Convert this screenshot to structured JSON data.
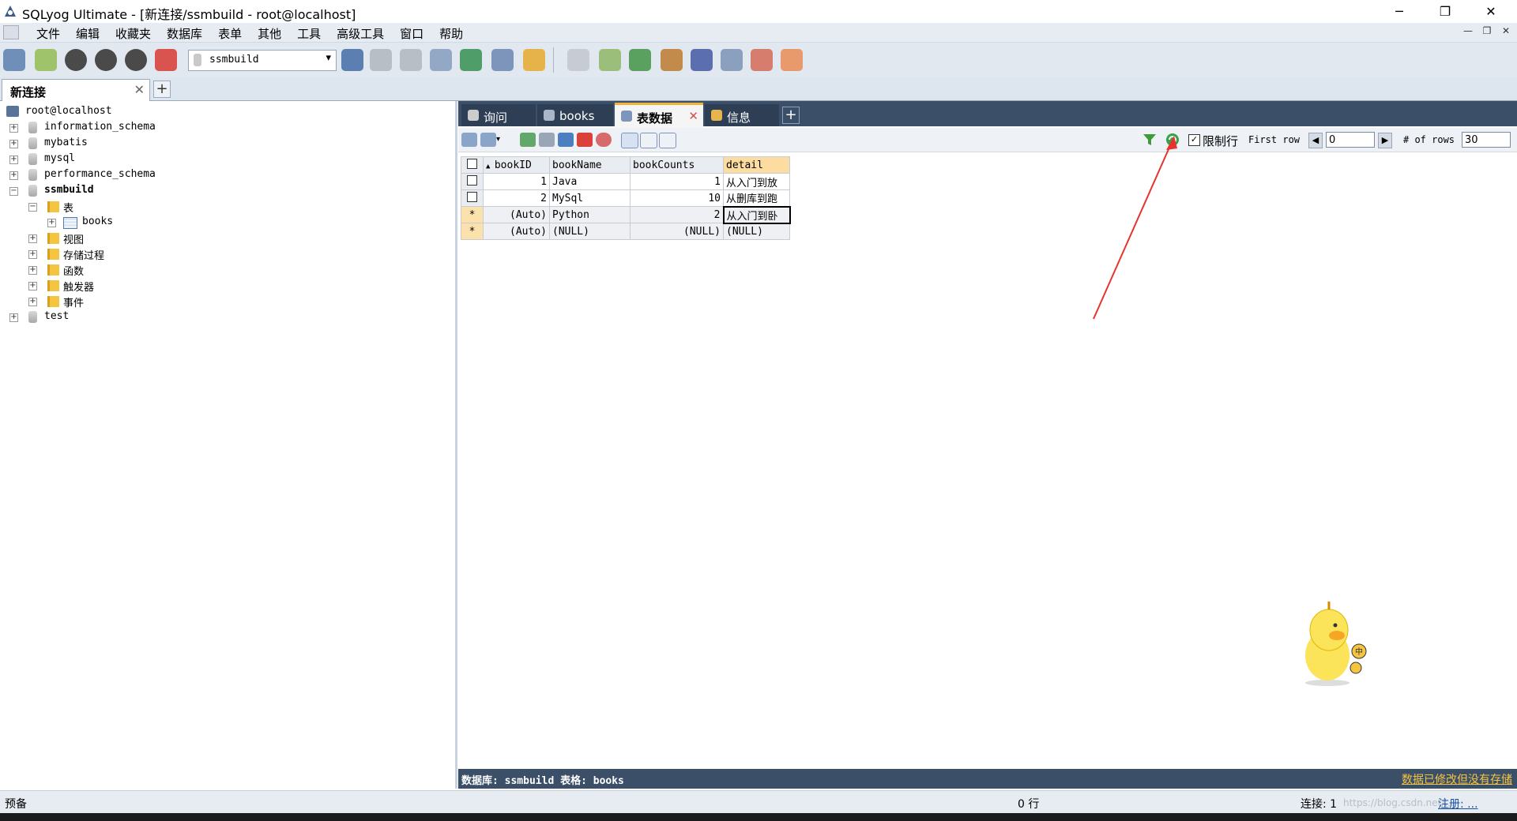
{
  "window": {
    "title": "SQLyog Ultimate - [新连接/ssmbuild - root@localhost]"
  },
  "menu": [
    "文件",
    "编辑",
    "收藏夹",
    "数据库",
    "表单",
    "其他",
    "工具",
    "高级工具",
    "窗口",
    "帮助"
  ],
  "toolbar": {
    "db_selector": "ssmbuild"
  },
  "connection_tab": {
    "label": "新连接",
    "close": "✕",
    "add": "+"
  },
  "object_browser": {
    "root": "root@localhost",
    "databases": [
      "information_schema",
      "mybatis",
      "mysql",
      "performance_schema",
      "ssmbuild",
      "test"
    ],
    "ssmbuild_children": {
      "tables_folder": "表",
      "table_books": "books",
      "folders": [
        "视图",
        "存储过程",
        "函数",
        "触发器",
        "事件"
      ]
    }
  },
  "query_tabs": [
    {
      "label": "询问"
    },
    {
      "label": "books"
    },
    {
      "label": "表数据",
      "active": true
    },
    {
      "label": "信息"
    }
  ],
  "grid_toolbar": {
    "limit_label": "限制行",
    "limit_checked": "✓",
    "first_row_label": "First row",
    "first_row_value": "0",
    "rows_label": "# of rows",
    "rows_value": "30"
  },
  "table": {
    "columns": [
      "bookID",
      "bookName",
      "bookCounts",
      "detail"
    ],
    "rows": [
      {
        "marker": "",
        "bookID": "1",
        "bookName": "Java",
        "bookCounts": "1",
        "detail": "从入门到放"
      },
      {
        "marker": "",
        "bookID": "2",
        "bookName": "MySql",
        "bookCounts": "10",
        "detail": "从删库到跑"
      },
      {
        "marker": "*",
        "bookID": "(Auto)",
        "bookName": "Python",
        "bookCounts": "2",
        "detail": "从入门到卧"
      },
      {
        "marker": "*",
        "bookID": "(Auto)",
        "bookName": "(NULL)",
        "bookCounts": "(NULL)",
        "detail": "(NULL)"
      }
    ]
  },
  "grid_status": {
    "left": "数据库:  ssmbuild  表格:  books",
    "right": "数据已修改但没有存储"
  },
  "status_bar": {
    "left": "预备",
    "rows": "0 行",
    "connections": "连接: 1",
    "register": "注册: ...",
    "watermark": "https://blog.csdn.net/..."
  },
  "colors": {
    "accent_tab": "#f0b33c",
    "dark_panel": "#3b4f69",
    "annotation_arrow": "#e8322d"
  }
}
